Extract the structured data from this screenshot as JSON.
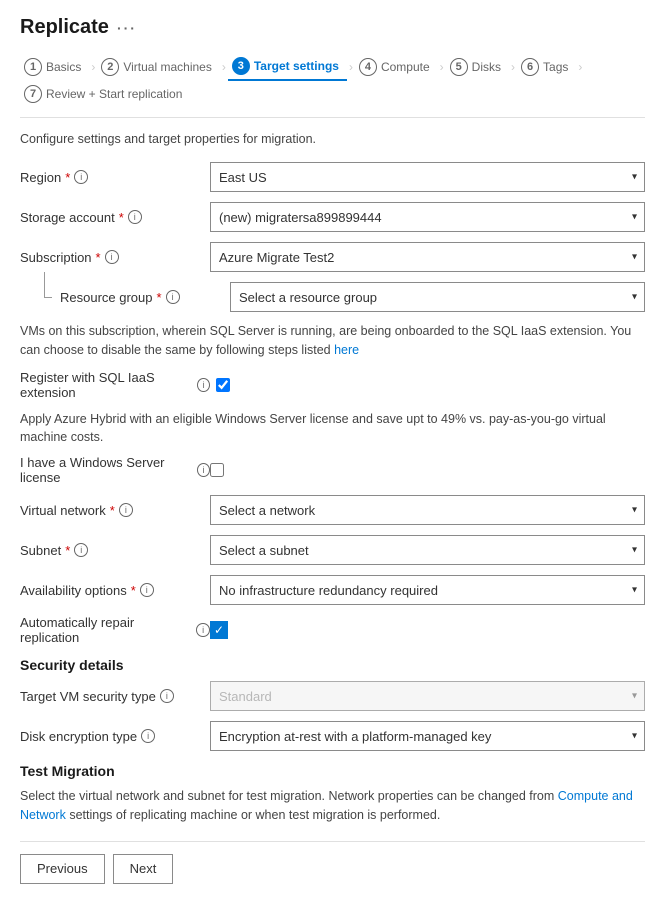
{
  "page": {
    "title": "Replicate",
    "ellipsis": "···"
  },
  "wizard": {
    "steps": [
      {
        "num": "1",
        "label": "Basics",
        "active": false
      },
      {
        "num": "2",
        "label": "Virtual machines",
        "active": false
      },
      {
        "num": "3",
        "label": "Target settings",
        "active": true
      },
      {
        "num": "4",
        "label": "Compute",
        "active": false
      },
      {
        "num": "5",
        "label": "Disks",
        "active": false
      },
      {
        "num": "6",
        "label": "Tags",
        "active": false
      },
      {
        "num": "7",
        "label": "Review + Start replication",
        "active": false
      }
    ]
  },
  "description": "Configure settings and target properties for migration.",
  "form": {
    "region_label": "Region",
    "region_value": "East US",
    "storage_label": "Storage account",
    "storage_value": "(new) migratersa899899444",
    "subscription_label": "Subscription",
    "subscription_value": "Azure Migrate Test2",
    "resource_group_label": "Resource group",
    "resource_group_placeholder": "Select a resource group",
    "sql_info_text": "VMs on this subscription, wherein SQL Server is running, are being onboarded to the SQL IaaS extension. You can choose to disable the same by following steps listed",
    "sql_link": "here",
    "register_sql_label": "Register with SQL IaaS extension",
    "azure_hybrid_text": "Apply Azure Hybrid with an eligible Windows Server license and save upt to 49% vs. pay-as-you-go virtual machine costs.",
    "windows_license_label": "I have a Windows Server license",
    "virtual_network_label": "Virtual network",
    "virtual_network_placeholder": "Select a network",
    "subnet_label": "Subnet",
    "subnet_placeholder": "Select a subnet",
    "availability_label": "Availability options",
    "availability_value": "No infrastructure redundancy required",
    "auto_repair_label": "Automatically repair replication",
    "security_section": "Security details",
    "target_vm_label": "Target VM security type",
    "target_vm_placeholder": "Standard",
    "disk_encryption_label": "Disk encryption type",
    "disk_encryption_value": "Encryption at-rest with a platform-managed key",
    "test_migration_section": "Test Migration",
    "test_migration_desc": "Select the virtual network and subnet for test migration. Network properties can be changed from Compute and Network settings of replicating machine or when test migration is performed.",
    "test_migration_link_text": "Compute and Network"
  },
  "buttons": {
    "previous": "Previous",
    "next": "Next"
  }
}
